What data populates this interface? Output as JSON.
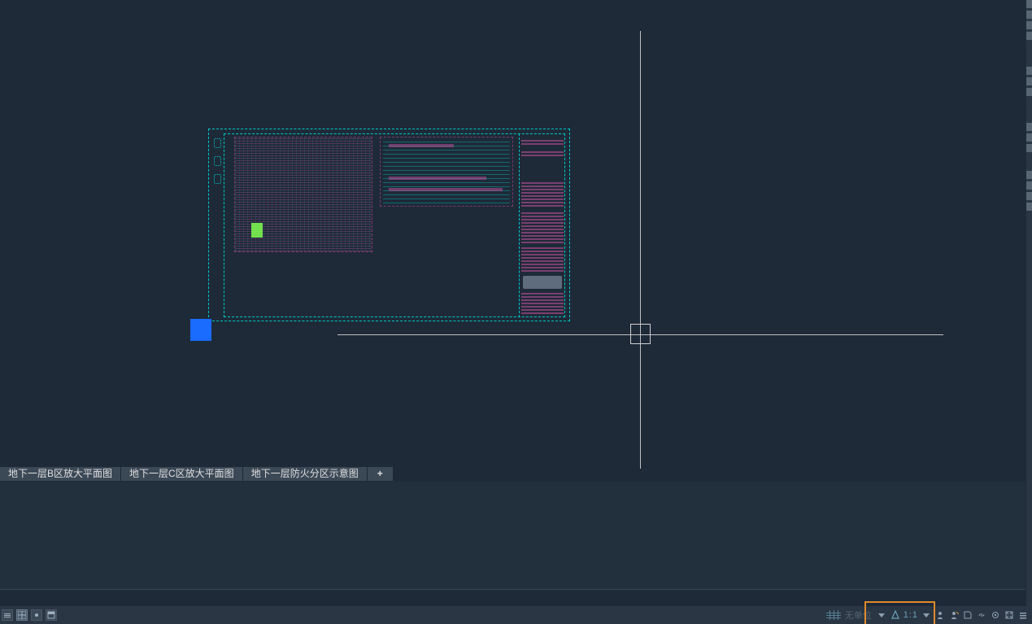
{
  "tabs": [
    {
      "label": "地下一层B区放大平面图"
    },
    {
      "label": "地下一层C区放大平面图"
    },
    {
      "label": "地下一层防火分区示意图"
    }
  ],
  "tab_add_label": "+",
  "status": {
    "units_label": "无单位",
    "scale_label": "1:1"
  },
  "icons": {
    "model": "model-icon",
    "grid": "grid-icon",
    "snap": "snap-icon",
    "layout": "layout-icon",
    "units_grid": "units-grid-icon",
    "dd1": "dropdown-icon",
    "scale_marker": "scale-marker-icon",
    "dd2": "dropdown-icon",
    "person1": "annotation-scale-icon",
    "person2": "annotation-visibility-icon",
    "sheet": "sheet-set-icon",
    "link": "link-icon",
    "gear": "settings-icon",
    "menu": "customize-menu-icon",
    "iso": "isolate-objects-icon"
  }
}
